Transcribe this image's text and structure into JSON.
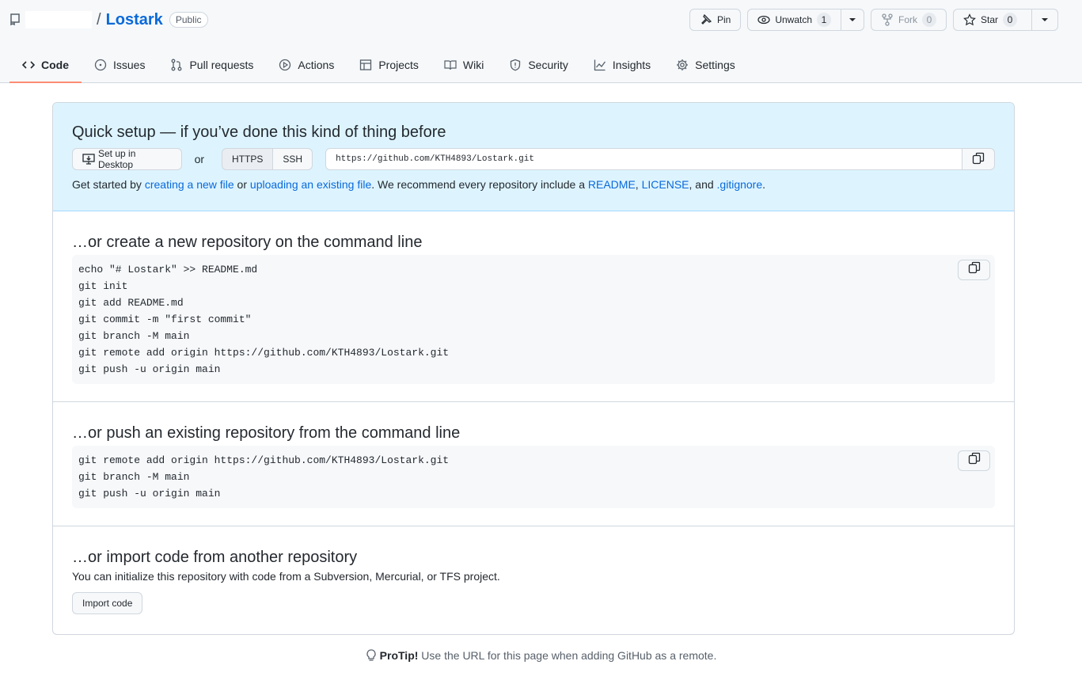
{
  "repo": {
    "owner": "",
    "slash": "/",
    "name": "Lostark",
    "visibility": "Public"
  },
  "actions": {
    "pin": "Pin",
    "unwatch": "Unwatch",
    "watch_count": "1",
    "fork": "Fork",
    "fork_count": "0",
    "star": "Star",
    "star_count": "0"
  },
  "tabs": [
    {
      "label": "Code",
      "icon": "code-icon",
      "active": true
    },
    {
      "label": "Issues",
      "icon": "issue-icon"
    },
    {
      "label": "Pull requests",
      "icon": "pull-request-icon"
    },
    {
      "label": "Actions",
      "icon": "play-icon"
    },
    {
      "label": "Projects",
      "icon": "table-icon"
    },
    {
      "label": "Wiki",
      "icon": "book-icon"
    },
    {
      "label": "Security",
      "icon": "shield-icon"
    },
    {
      "label": "Insights",
      "icon": "graph-icon"
    },
    {
      "label": "Settings",
      "icon": "gear-icon"
    }
  ],
  "quick_setup": {
    "title": "Quick setup — if you’ve done this kind of thing before",
    "desktop_button": "Set up in Desktop",
    "or": "or",
    "https": "HTTPS",
    "ssh": "SSH",
    "url": "https://github.com/KTH4893/Lostark.git",
    "get_started": {
      "prefix": "Get started by ",
      "link1": "creating a new file",
      "mid1": " or ",
      "link2": "uploading an existing file",
      "mid2": ". We recommend every repository include a ",
      "link3": "README",
      "comma": ", ",
      "link4": "LICENSE",
      "and": ", and ",
      "link5": ".gitignore",
      "suffix": "."
    }
  },
  "new_repo": {
    "title": "…or create a new repository on the command line",
    "lines": [
      "echo \"# Lostark\" >> README.md",
      "git init",
      "git add README.md",
      "git commit -m \"first commit\"",
      "git branch -M main",
      "git remote add origin https://github.com/KTH4893/Lostark.git",
      "git push -u origin main"
    ]
  },
  "push_existing": {
    "title": "…or push an existing repository from the command line",
    "lines": [
      "git remote add origin https://github.com/KTH4893/Lostark.git",
      "git branch -M main",
      "git push -u origin main"
    ]
  },
  "import": {
    "title": "…or import code from another repository",
    "description": "You can initialize this repository with code from a Subversion, Mercurial, or TFS project.",
    "button": "Import code"
  },
  "protip": {
    "label": "ProTip!",
    "text": " Use the URL for this page when adding GitHub as a remote."
  }
}
